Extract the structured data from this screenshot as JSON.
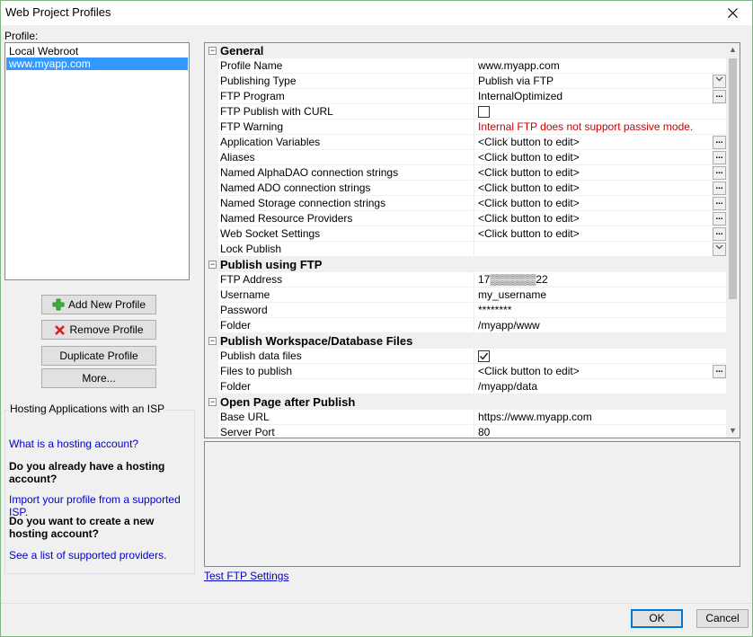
{
  "window": {
    "title": "Web Project Profiles"
  },
  "profile_label": "Profile:",
  "profiles": [
    {
      "label": "Local Webroot",
      "selected": false
    },
    {
      "label": "www.myapp.com",
      "selected": true
    }
  ],
  "buttons": {
    "add": "Add New Profile",
    "remove": "Remove Profile",
    "duplicate": "Duplicate Profile",
    "more": "More..."
  },
  "isp": {
    "header": "Hosting Applications with an ISP",
    "link1": "What is a hosting account?",
    "q1": "Do you already have a hosting account?",
    "link2": "Import your profile from a supported ISP.",
    "q2": "Do you want to create a new hosting account?",
    "link3": "See a list of supported providers."
  },
  "grid": {
    "categories": {
      "general": "General",
      "ftp": "Publish using FTP",
      "workspace": "Publish Workspace/Database Files",
      "open_page": "Open Page after Publish"
    },
    "collapse_glyph": "−",
    "ellipsis": "...",
    "rows": {
      "profile_name": {
        "name": "Profile Name",
        "value": "www.myapp.com"
      },
      "publishing_type": {
        "name": "Publishing Type",
        "value": "Publish via FTP"
      },
      "ftp_program": {
        "name": "FTP Program",
        "value": "InternalOptimized"
      },
      "ftp_curl": {
        "name": "FTP Publish with CURL"
      },
      "ftp_warning": {
        "name": "FTP Warning",
        "value": "Internal FTP does not support passive mode."
      },
      "app_vars": {
        "name": "Application Variables",
        "value": "<Click button to edit>"
      },
      "aliases": {
        "name": "Aliases",
        "value": "<Click button to edit>"
      },
      "alphadao": {
        "name": "Named AlphaDAO connection strings",
        "value": "<Click button to edit>"
      },
      "ado": {
        "name": "Named ADO connection strings",
        "value": "<Click button to edit>"
      },
      "storage": {
        "name": "Named Storage connection strings",
        "value": "<Click button to edit>"
      },
      "resource": {
        "name": "Named Resource Providers",
        "value": "<Click button to edit>"
      },
      "websocket": {
        "name": "Web Socket Settings",
        "value": "<Click button to edit>"
      },
      "lock_publish": {
        "name": "Lock Publish",
        "value": ""
      },
      "ftp_address": {
        "name": "FTP Address",
        "value": "17▒▒▒▒▒▒22"
      },
      "username": {
        "name": "Username",
        "value": "my_username"
      },
      "password": {
        "name": "Password",
        "value": "********"
      },
      "ftp_folder": {
        "name": "Folder",
        "value": "/myapp/www"
      },
      "publish_data": {
        "name": "Publish data files"
      },
      "files_to_publish": {
        "name": "Files to publish",
        "value": "<Click button to edit>"
      },
      "data_folder": {
        "name": "Folder",
        "value": "/myapp/data"
      },
      "base_url": {
        "name": "Base URL",
        "value": "https://www.myapp.com"
      },
      "server_port": {
        "name": "Server Port",
        "value": "80"
      }
    }
  },
  "test_ftp": "Test FTP Settings",
  "ok": "OK",
  "cancel": "Cancel",
  "colors": {
    "selection": "#3399ff",
    "link": "#0000cc",
    "warning": "#cc0000",
    "default_button_border": "#0078d7"
  }
}
